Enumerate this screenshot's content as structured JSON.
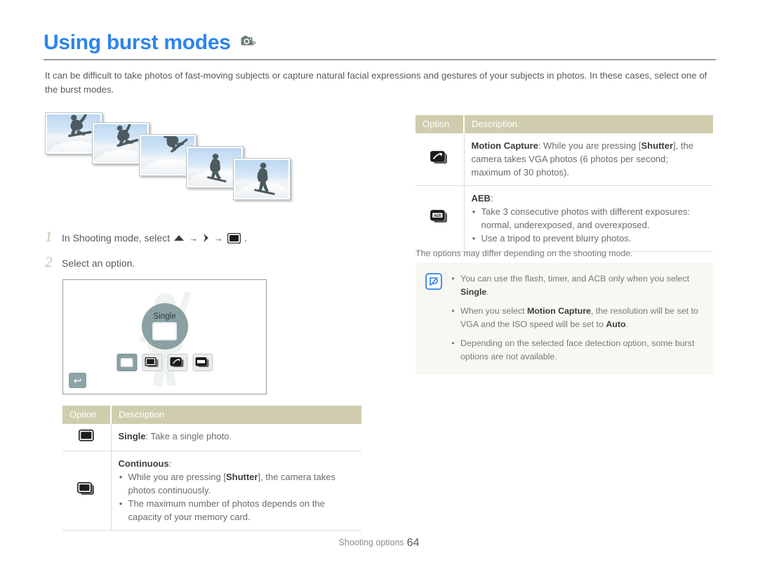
{
  "header": {
    "title": "Using burst modes",
    "mode_icon": "camera-p-icon",
    "intro": "It can be difficult to take photos of fast-moving subjects or capture natural facial expressions and gestures of your subjects in photos. In these cases, select one of the burst modes."
  },
  "illustration": {
    "name": "burst-photo-sequence",
    "frames": 5,
    "subject": "snowboarder-silhouette"
  },
  "steps": [
    {
      "num": "1",
      "text_before": "In Shooting mode, select",
      "icons": [
        "up-triangle-icon",
        "right-chevron-icon",
        "single-frame-icon"
      ],
      "arrow": "→",
      "text_after": "."
    },
    {
      "num": "2",
      "text_before": "Select an option.",
      "icons": [],
      "arrow": "",
      "text_after": ""
    }
  ],
  "lcd": {
    "dial_label": "Single",
    "back_glyph": "↩",
    "options": [
      {
        "name": "single",
        "selected": true
      },
      {
        "name": "continuous",
        "selected": false
      },
      {
        "name": "motion-capture",
        "selected": false
      },
      {
        "name": "aeb",
        "selected": false
      }
    ]
  },
  "table_left": {
    "headers": {
      "option": "Option",
      "description": "Description"
    },
    "rows": [
      {
        "icon": "single-frame-icon",
        "term": "Single",
        "term_suffix": ": Take a single photo.",
        "bullets": []
      },
      {
        "icon": "continuous-frames-icon",
        "term": "Continuous",
        "term_suffix": ":",
        "bullets": [
          "While you are pressing [Shutter], the camera takes photos continuously.",
          "The maximum number of photos depends on the capacity of your memory card."
        ]
      }
    ]
  },
  "table_right": {
    "headers": {
      "option": "Option",
      "description": "Description"
    },
    "rows": [
      {
        "icon": "motion-capture-icon",
        "term": "Motion Capture",
        "term_suffix": ": While you are pressing [Shutter], the camera takes VGA photos (6 photos per second; maximum of 30 photos).",
        "bullets": []
      },
      {
        "icon": "aeb-icon",
        "term": "AEB",
        "term_suffix": ":",
        "bullets": [
          "Take 3 consecutive photos with different exposures: normal, underexposed, and overexposed.",
          "Use a tripod to prevent blurry photos."
        ]
      }
    ]
  },
  "note_caption": "The options may differ depending on the shooting mode.",
  "note_box": {
    "icon": "note-pen-icon",
    "bullets": [
      "You can use the flash, timer, and ACB only when you select Single.",
      "When you select Motion Capture, the resolution will be set to VGA and the ISO speed will be set to Auto.",
      "Depending on the selected face detection option, some burst options are not available."
    ]
  },
  "footer": {
    "section": "Shooting options",
    "page": "64"
  },
  "colors": {
    "title_blue": "#2d84ec",
    "table_header_khaki": "#cfcdae",
    "step_number_green": "#b4ccab",
    "lcd_teal": "#8aa0a2",
    "note_bg": "#f8f7f2",
    "body_text": "#58595b"
  }
}
